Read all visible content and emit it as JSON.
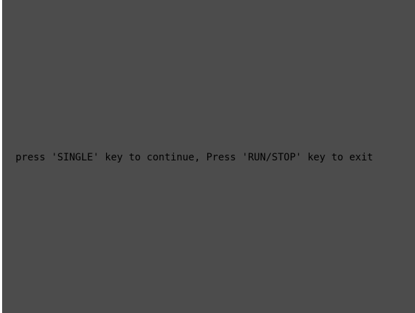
{
  "screen": {
    "background_color": "#4c4c4c",
    "prompt_text": "press 'SINGLE' key to continue, Press 'RUN/STOP' key to exit"
  }
}
